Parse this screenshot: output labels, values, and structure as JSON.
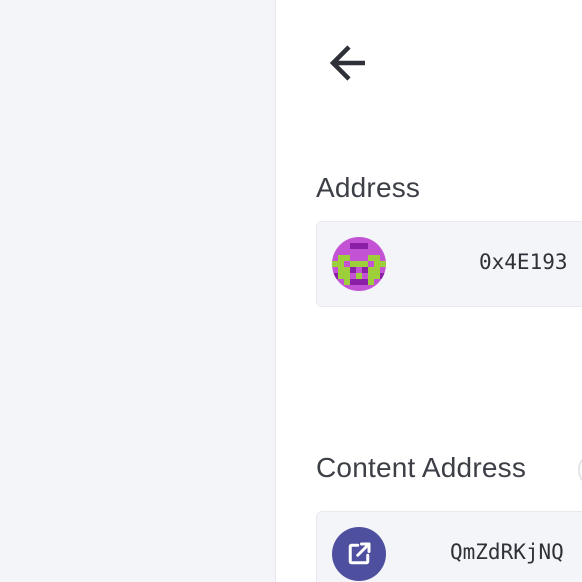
{
  "header": {
    "back_icon": "arrow-left-icon"
  },
  "address": {
    "label": "Address",
    "value": "0x4E193",
    "avatar_icon": "identicon",
    "avatar_colors": [
      "#c352d4",
      "#9ccf3a",
      "#8a1fa8"
    ]
  },
  "content_address": {
    "label": "Content Address",
    "value": "QmZdRKjNQ",
    "link_icon": "external-link-icon",
    "link_icon_color": "#4e4f9e"
  },
  "colors": {
    "sidebar_bg": "#f3f5f9",
    "field_bg": "#f4f5f8",
    "text": "#3d3f47"
  }
}
